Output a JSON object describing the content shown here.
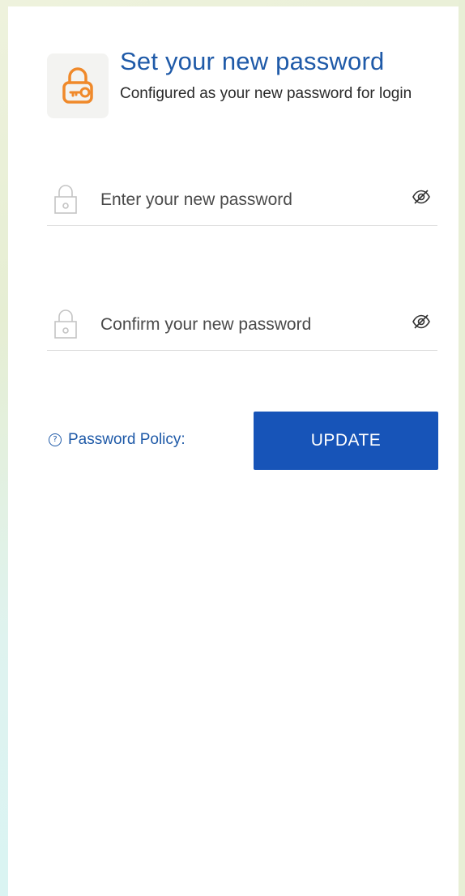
{
  "header": {
    "title": "Set your new password",
    "subtitle": "Configured as your new password for login",
    "icon": "padlock-key-icon",
    "icon_color": "#f0892a"
  },
  "fields": {
    "new_password": {
      "placeholder": "Enter your new password",
      "value": "",
      "lock_icon": "lock-icon",
      "toggle_icon": "eye-off-icon"
    },
    "confirm_password": {
      "placeholder": "Confirm your new password",
      "value": "",
      "lock_icon": "lock-icon",
      "toggle_icon": "eye-off-icon"
    }
  },
  "policy": {
    "icon": "help-circle-icon",
    "icon_glyph": "?",
    "label": "Password Policy:"
  },
  "actions": {
    "update_label": "UPDATE"
  },
  "colors": {
    "accent": "#1f5aa8",
    "button": "#1754b8",
    "icon_orange": "#f0892a"
  }
}
